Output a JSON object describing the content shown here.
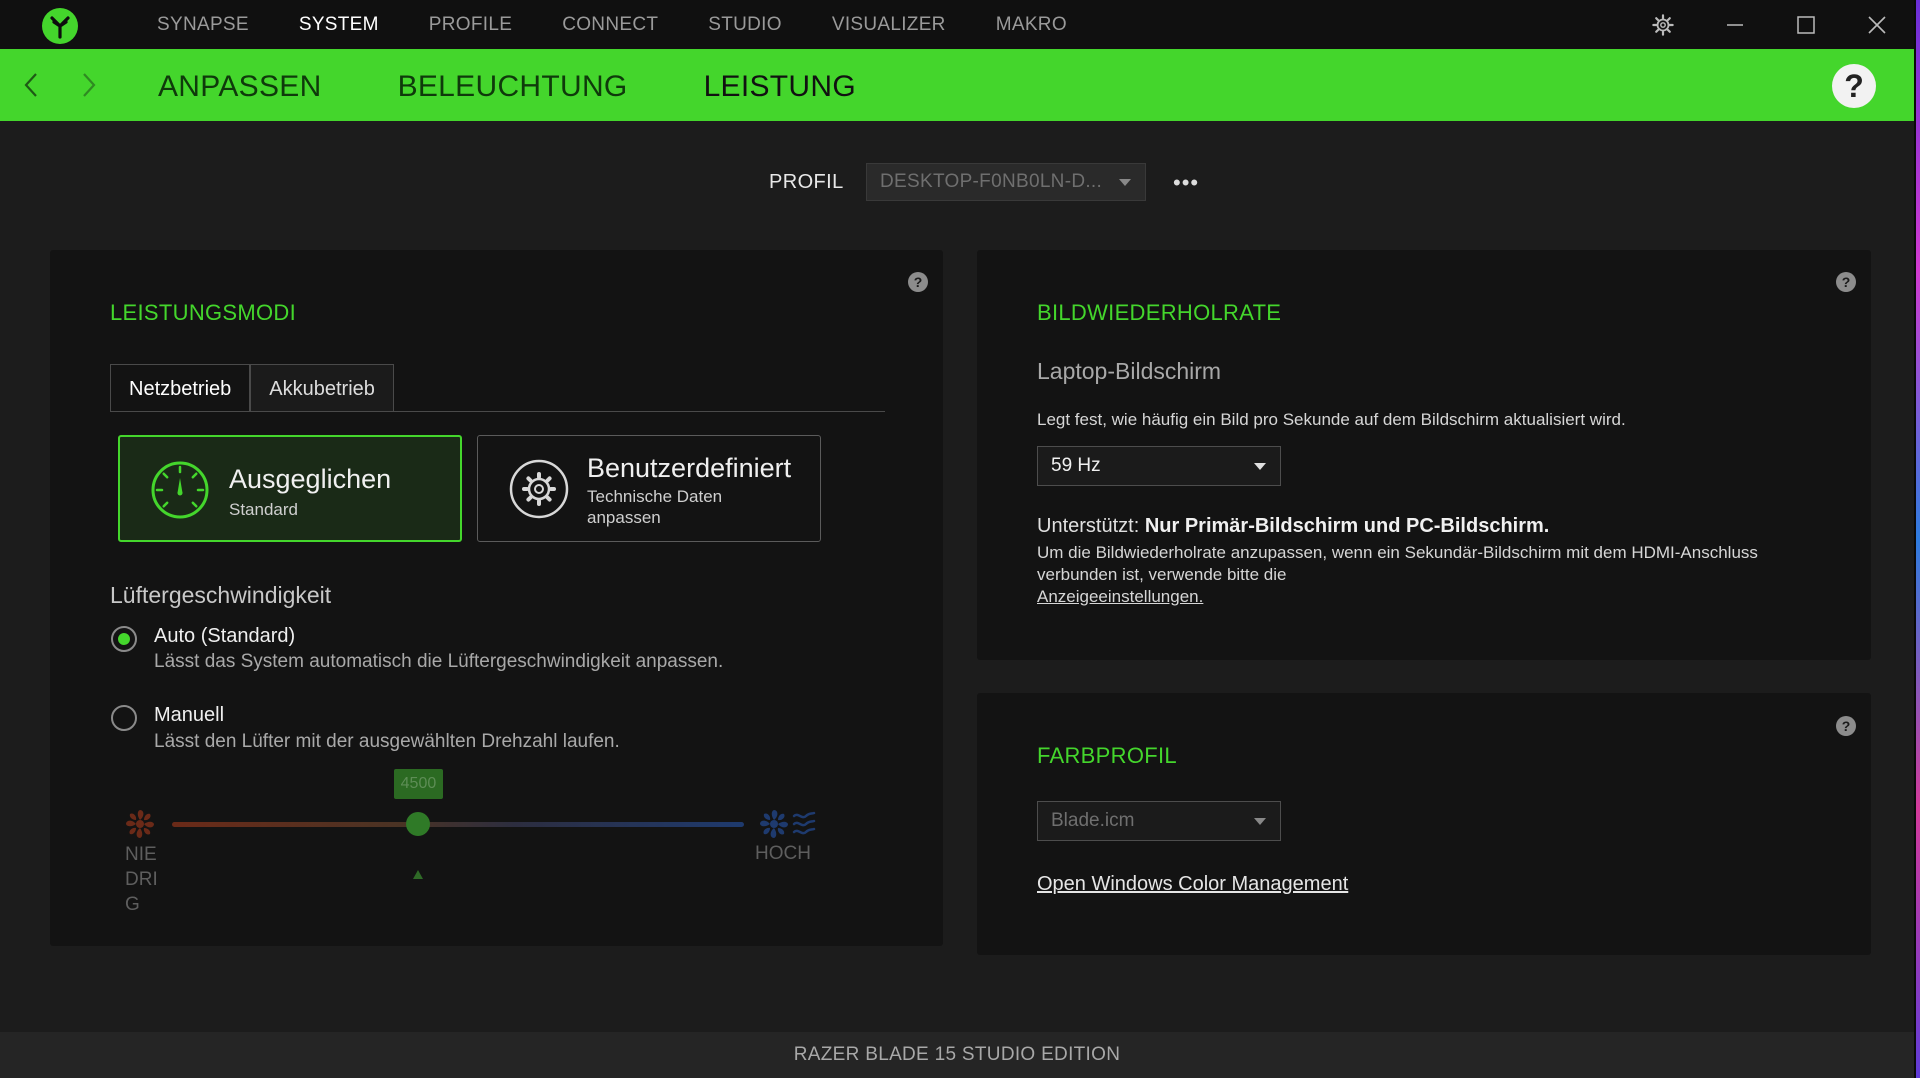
{
  "app": {
    "footer": "RAZER BLADE 15 STUDIO EDITION"
  },
  "topnav": {
    "items": [
      {
        "label": "SYNAPSE"
      },
      {
        "label": "SYSTEM"
      },
      {
        "label": "PROFILE"
      },
      {
        "label": "CONNECT"
      },
      {
        "label": "STUDIO"
      },
      {
        "label": "VISUALIZER"
      },
      {
        "label": "MAKRO"
      }
    ],
    "active": "SYSTEM"
  },
  "subnav": {
    "tabs": [
      {
        "label": "ANPASSEN"
      },
      {
        "label": "BELEUCHTUNG"
      },
      {
        "label": "LEISTUNG"
      }
    ],
    "active": "LEISTUNG",
    "help": "?"
  },
  "profile": {
    "label": "PROFIL",
    "value": "DESKTOP-F0NB0LN-D...",
    "more": "•••"
  },
  "performance": {
    "title": "LEISTUNGSMODI",
    "help": "?",
    "tabs": [
      {
        "label": "Netzbetrieb"
      },
      {
        "label": "Akkubetrieb"
      }
    ],
    "active_tab": "Netzbetrieb",
    "modes": [
      {
        "title": "Ausgeglichen",
        "subtitle": "Standard",
        "selected": true,
        "icon": "speedometer-icon"
      },
      {
        "title": "Benutzerdefiniert",
        "subtitle_line1": "Technische Daten",
        "subtitle_line2": "anpassen",
        "selected": false,
        "icon": "gear-icon"
      }
    ],
    "fan": {
      "title": "Lüftergeschwindigkeit",
      "options": [
        {
          "label": "Auto (Standard)",
          "desc": "Lässt das System automatisch die Lüftergeschwindigkeit anpassen.",
          "selected": true
        },
        {
          "label": "Manuell",
          "desc": "Lässt den Lüfter mit der ausgewählten Drehzahl laufen.",
          "selected": false
        }
      ],
      "slider": {
        "value": "4500",
        "fraction": 0.43,
        "low_label_1": "NIE",
        "low_label_2": "DRI",
        "low_label_3": "G",
        "high_label": "HOCH"
      }
    }
  },
  "refresh": {
    "title": "BILDWIEDERHOLRATE",
    "help": "?",
    "subtitle": "Laptop-Bildschirm",
    "description": "Legt fest, wie häufig ein Bild pro Sekunde auf dem Bildschirm aktualisiert wird.",
    "selected": "59 Hz",
    "supported_label": "Unterstützt:",
    "supported_value": "Nur Primär-Bildschirm und PC-Bildschirm.",
    "note_line1": "Um die Bildwiederholrate anzupassen, wenn ein Sekundär-Bildschirm mit dem HDMI-Anschluss",
    "note_line2": "verbunden ist, verwende bitte die",
    "note_link": "Anzeigeeinstellungen."
  },
  "color_profile": {
    "title": "FARBPROFIL",
    "help": "?",
    "selected": "Blade.icm",
    "link": "Open Windows Color Management"
  },
  "colors": {
    "accent": "#44d62c",
    "background": "#1c1c1c",
    "card": "#131313"
  }
}
